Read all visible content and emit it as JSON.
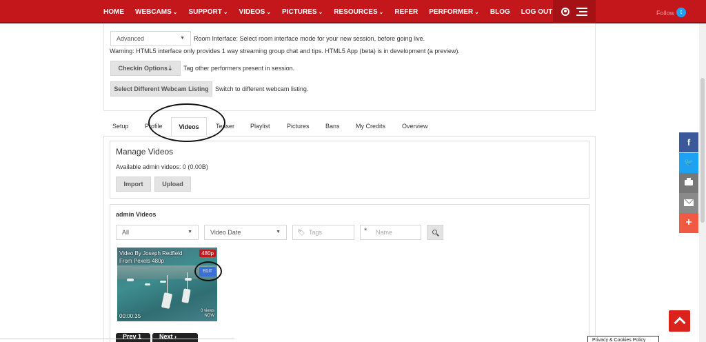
{
  "nav": {
    "items": [
      {
        "label": "HOME",
        "caret": ""
      },
      {
        "label": "WEBCAMS",
        "caret": "⌄"
      },
      {
        "label": "SUPPORT",
        "caret": "⌄"
      },
      {
        "label": "VIDEOS",
        "caret": "⌄"
      },
      {
        "label": "PICTURES",
        "caret": "⌄"
      },
      {
        "label": "RESOURCES",
        "caret": "⌄"
      },
      {
        "label": "REFER",
        "caret": ""
      },
      {
        "label": "PERFORMER",
        "caret": "⌄"
      },
      {
        "label": "BLOG",
        "caret": ""
      },
      {
        "label": "LOG OUT",
        "caret": ""
      }
    ],
    "follow_label": "Follow"
  },
  "settings": {
    "interface_select": "Advanced",
    "interface_help": "Room Interface: Select room interface mode for your new session, before going live.",
    "warning": "Warning: HTML5 interface only provides 1 way streaming group chat and tips. HTML5 App (beta) is in development (a preview).",
    "checkin_button": "Checkin Options",
    "checkin_arrow": "⇣",
    "checkin_help": "Tag other performers present in session.",
    "switch_button": "Select Different Webcam Listing",
    "switch_help": "Switch to different webcam listing."
  },
  "tabs": [
    "Setup",
    "Profile",
    "Videos",
    "Teaser",
    "Playlist",
    "Pictures",
    "Bans",
    "My Credits",
    "Overview"
  ],
  "manage": {
    "title": "Manage Videos",
    "available": "Available admin videos: 0 (0.00B)",
    "import_button": "Import",
    "upload_button": "Upload"
  },
  "list": {
    "title": "admin Videos",
    "filter_all": "All",
    "sort_by": "Video Date",
    "tags_placeholder": "Tags",
    "name_placeholder": "Name",
    "name_prefix": "*"
  },
  "video": {
    "title": "Video By Joseph Redfield From Pexels 480p",
    "quality_badge": "480p",
    "edit_label": "EDIT",
    "duration": "00:00:35",
    "views": "0 views",
    "age": "NOW"
  },
  "pager": {
    "prev": "Prev 1",
    "next": "Next ›"
  },
  "share": {
    "facebook": "f",
    "twitter": "🐦",
    "plus": "+"
  },
  "cookie": "Privacy & Cookies Policy",
  "colors": {
    "nav_red": "#c4171c",
    "facebook": "#3b5998",
    "twitter": "#1da1f2",
    "print": "#777777",
    "email": "#8a8a8a",
    "plus": "#f05a44",
    "to_top": "#d8241d"
  }
}
